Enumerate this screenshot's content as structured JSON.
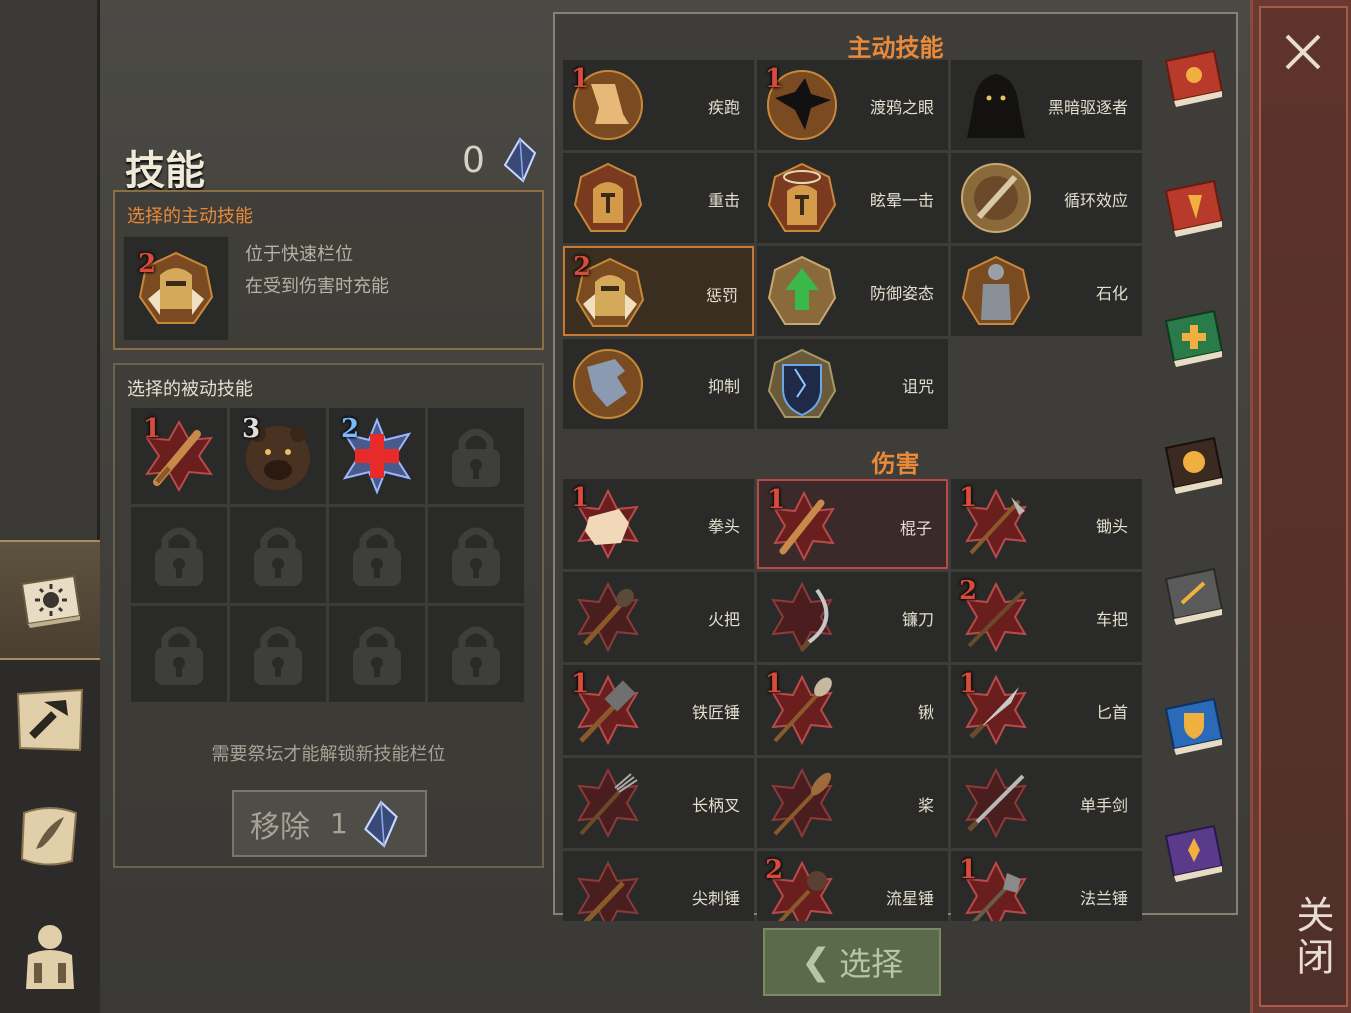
{
  "title": "技能",
  "crystal_count": "0",
  "active_box": {
    "label": "选择的主动技能",
    "level": "2",
    "desc1": "位于快速栏位",
    "desc2": "在受到伤害时充能"
  },
  "passive_box": {
    "label": "选择的被动技能",
    "slots": [
      {
        "level": "1",
        "icon": "club-icon"
      },
      {
        "level": "3",
        "icon": "bear-icon"
      },
      {
        "level": "2",
        "icon": "medic-cross-icon"
      }
    ],
    "hint": "需要祭坛才能解锁新技能栏位",
    "remove_label": "移除",
    "remove_cost": "1"
  },
  "active_section": {
    "title": "主动技能",
    "skills": [
      {
        "name": "疾跑",
        "level": "1"
      },
      {
        "name": "渡鸦之眼",
        "level": "1"
      },
      {
        "name": "黑暗驱逐者",
        "level": ""
      },
      {
        "name": "重击",
        "level": ""
      },
      {
        "name": "眩晕一击",
        "level": ""
      },
      {
        "name": "循环效应",
        "level": ""
      },
      {
        "name": "惩罚",
        "level": "2"
      },
      {
        "name": "防御姿态",
        "level": ""
      },
      {
        "name": "石化",
        "level": ""
      },
      {
        "name": "抑制",
        "level": ""
      },
      {
        "name": "诅咒",
        "level": ""
      }
    ]
  },
  "damage_section": {
    "title": "伤害",
    "skills": [
      {
        "name": "拳头",
        "level": "1"
      },
      {
        "name": "棍子",
        "level": "1"
      },
      {
        "name": "锄头",
        "level": "1"
      },
      {
        "name": "火把",
        "level": ""
      },
      {
        "name": "镰刀",
        "level": ""
      },
      {
        "name": "车把",
        "level": "2"
      },
      {
        "name": "铁匠锤",
        "level": "1"
      },
      {
        "name": "锹",
        "level": "1"
      },
      {
        "name": "匕首",
        "level": "1"
      },
      {
        "name": "长柄叉",
        "level": ""
      },
      {
        "name": "桨",
        "level": ""
      },
      {
        "name": "单手剑",
        "level": ""
      },
      {
        "name": "尖刺锤",
        "level": ""
      },
      {
        "name": "流星锤",
        "level": "2"
      },
      {
        "name": "法兰锤",
        "level": "1"
      }
    ]
  },
  "close_label": "关闭",
  "select_label": "选择",
  "colors": {
    "accent": "#e88a3a",
    "close_bg": "#6a3a32",
    "select_bg": "#5a6a4a"
  }
}
